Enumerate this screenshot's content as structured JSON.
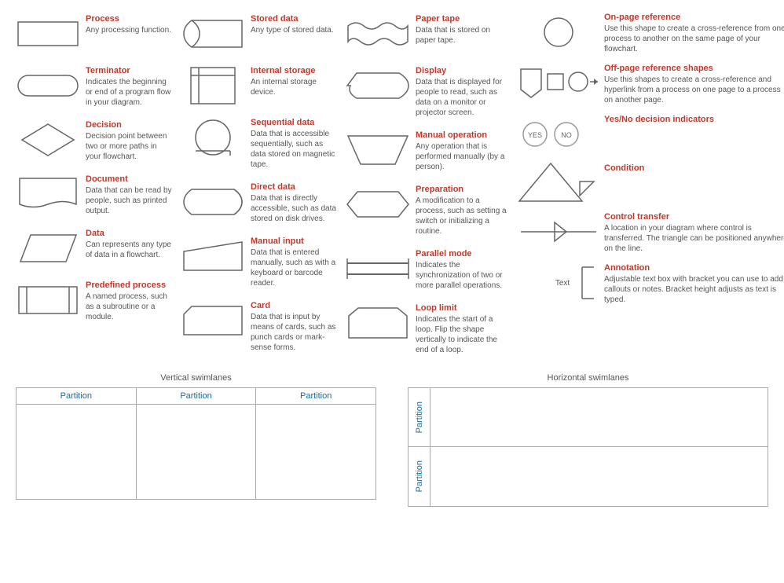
{
  "shapes": {
    "col1": [
      {
        "id": "process",
        "title": "Process",
        "desc": "Any processing function.",
        "shape": "rect"
      },
      {
        "id": "terminator",
        "title": "Terminator",
        "desc": "Indicates the beginning or end of a program flow in your diagram.",
        "shape": "stadium"
      },
      {
        "id": "decision",
        "title": "Decision",
        "desc": "Decision point between two or more paths in your flowchart.",
        "shape": "diamond"
      },
      {
        "id": "document",
        "title": "Document",
        "desc": "Data that can be read by people, such as printed output.",
        "shape": "document"
      },
      {
        "id": "data",
        "title": "Data",
        "desc": "Can represents any type of data in a flowchart.",
        "shape": "parallelogram"
      },
      {
        "id": "predefined-process",
        "title": "Predefined process",
        "desc": "A named process, such as a subroutine or a module.",
        "shape": "predefined"
      }
    ],
    "col2": [
      {
        "id": "stored-data",
        "title": "Stored data",
        "desc": "Any type of stored data.",
        "shape": "stored"
      },
      {
        "id": "internal-storage",
        "title": "Internal storage",
        "desc": "An internal storage device.",
        "shape": "internal"
      },
      {
        "id": "sequential-data",
        "title": "Sequential data",
        "desc": "Data that is accessible sequentially, such as data stored on magnetic tape.",
        "shape": "sequential"
      },
      {
        "id": "direct-data",
        "title": "Direct data",
        "desc": "Data that is directly accessible, such as data stored on disk drives.",
        "shape": "direct"
      },
      {
        "id": "manual-input",
        "title": "Manual input",
        "desc": "Data that is entered manually, such as with a keyboard or barcode reader.",
        "shape": "manual-input"
      },
      {
        "id": "card",
        "title": "Card",
        "desc": "Data that is input by means of cards, such as punch cards or mark-sense forms.",
        "shape": "card"
      }
    ],
    "col3": [
      {
        "id": "paper-tape",
        "title": "Paper tape",
        "desc": "Data that is stored on paper tape.",
        "shape": "paper-tape"
      },
      {
        "id": "display",
        "title": "Display",
        "desc": "Data that is displayed for people to read, such as data on a monitor or projector screen.",
        "shape": "display"
      },
      {
        "id": "manual-operation",
        "title": "Manual operation",
        "desc": "Any operation that is performed manually (by a person).",
        "shape": "trapezoid"
      },
      {
        "id": "preparation",
        "title": "Preparation",
        "desc": "A modification to a process, such as setting a switch or initializing a routine.",
        "shape": "hexagon"
      },
      {
        "id": "parallel-mode",
        "title": "Parallel mode",
        "desc": "Indicates the synchronization of two or more parallel operations.",
        "shape": "parallel"
      },
      {
        "id": "loop-limit",
        "title": "Loop limit",
        "desc": "Indicates the start of a loop. Flip the shape vertically to indicate the end of a loop.",
        "shape": "loop"
      }
    ],
    "col4": [
      {
        "id": "on-page-ref",
        "title": "On-page reference",
        "desc": "Use this shape to create a cross-reference from one process to another on the same page of your flowchart.",
        "shape": "circle"
      },
      {
        "id": "off-page-ref",
        "title": "Off-page reference shapes",
        "desc": "Use this shapes to create a cross-reference and hyperlink from a process on one page to a process on another page.",
        "shape": "off-page"
      },
      {
        "id": "yes-no",
        "title": "Yes/No decision indicators",
        "desc": "",
        "shape": "yes-no"
      },
      {
        "id": "condition",
        "title": "Condition",
        "desc": "",
        "shape": "condition"
      },
      {
        "id": "control-transfer",
        "title": "Control transfer",
        "desc": "A location in your diagram where control is transferred. The triangle can be positioned anywhere on the line.",
        "shape": "control"
      },
      {
        "id": "annotation",
        "title": "Annotation",
        "desc": "Adjustable text box with bracket you can use to add callouts or notes. Bracket height adjusts as text is typed.",
        "shape": "annotation"
      }
    ]
  },
  "swimlanes": {
    "vertical": {
      "title": "Vertical swimlanes",
      "partitions": [
        "Partition",
        "Partition",
        "Partition"
      ]
    },
    "horizontal": {
      "title": "Horizontal swimlanes",
      "partitions": [
        "Partition",
        "Partition"
      ]
    }
  }
}
